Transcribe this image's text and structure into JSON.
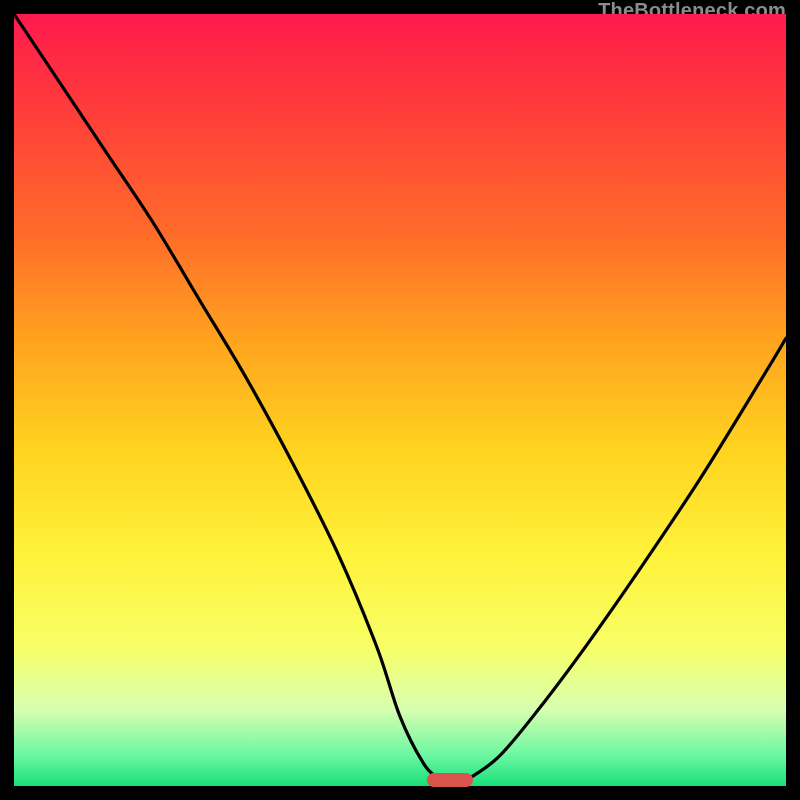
{
  "watermark": "TheBottleneck.com",
  "chart_data": {
    "type": "line",
    "title": "",
    "xlabel": "",
    "ylabel": "",
    "xlim": [
      0,
      100
    ],
    "ylim": [
      0,
      100
    ],
    "grid": false,
    "legend": false,
    "series": [
      {
        "name": "bottleneck-curve",
        "x": [
          0,
          6,
          12,
          18,
          24,
          30,
          36,
          42,
          47,
          50,
          53,
          55,
          57,
          59,
          63,
          68,
          74,
          81,
          89,
          97,
          100
        ],
        "y": [
          100,
          91,
          82,
          73,
          63,
          53,
          42,
          30,
          18,
          9,
          3,
          1,
          0,
          1,
          4,
          10,
          18,
          28,
          40,
          53,
          58
        ]
      }
    ],
    "marker": {
      "x": 56.5,
      "y": 0.8,
      "color": "#d9544f"
    },
    "gradient_stops": [
      {
        "pos": 0,
        "color": "#ff1a4d"
      },
      {
        "pos": 12,
        "color": "#ff3b3b"
      },
      {
        "pos": 28,
        "color": "#ff6a2a"
      },
      {
        "pos": 42,
        "color": "#ffa21f"
      },
      {
        "pos": 56,
        "color": "#ffd21f"
      },
      {
        "pos": 70,
        "color": "#fff23a"
      },
      {
        "pos": 82,
        "color": "#f7ff66"
      },
      {
        "pos": 90,
        "color": "#d8ffb0"
      },
      {
        "pos": 96,
        "color": "#6cf7a2"
      },
      {
        "pos": 100,
        "color": "#18e07a"
      }
    ]
  }
}
